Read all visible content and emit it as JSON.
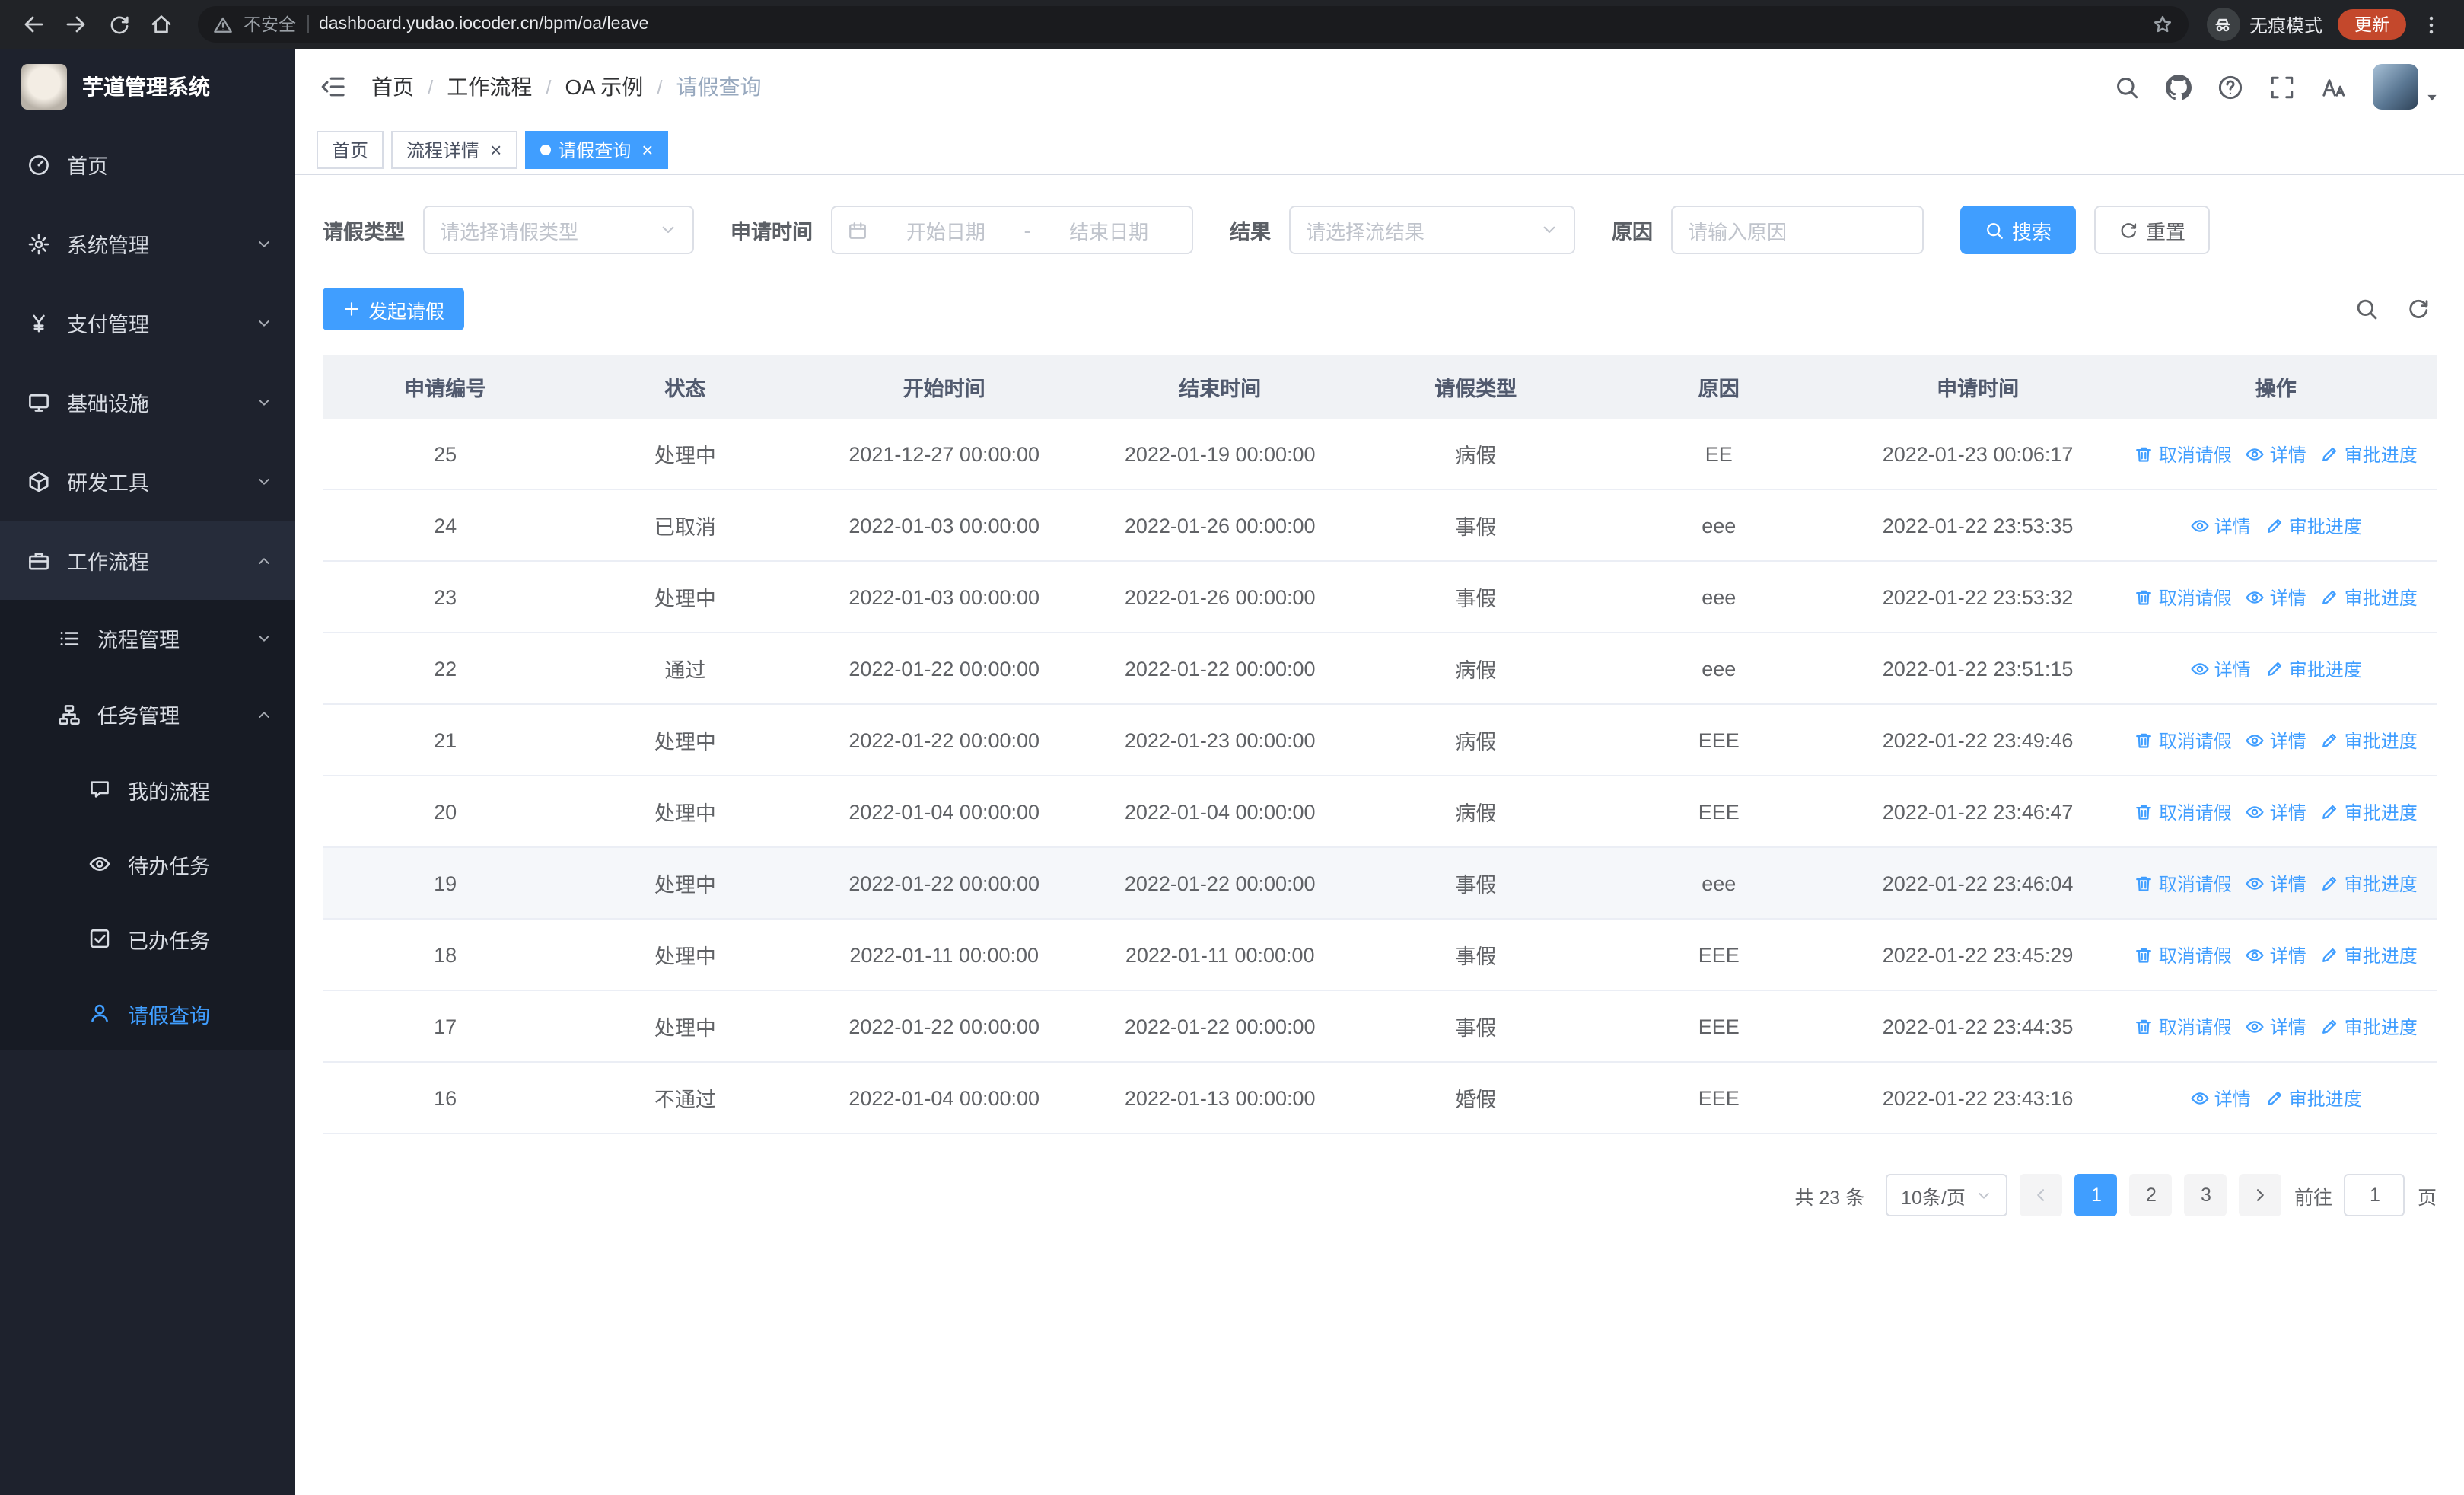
{
  "accent_color": "#409eff",
  "browser": {
    "security_label": "不安全",
    "url": "dashboard.yudao.iocoder.cn/bpm/oa/leave",
    "incognito_label": "无痕模式",
    "update_label": "更新"
  },
  "sidebar": {
    "title": "芋道管理系统",
    "menu": [
      {
        "label": "首页",
        "icon": "dashboard-icon",
        "level": 1
      },
      {
        "label": "系统管理",
        "icon": "gear-icon",
        "level": 1,
        "arrow": "down"
      },
      {
        "label": "支付管理",
        "icon": "yuan-icon",
        "level": 1,
        "arrow": "down"
      },
      {
        "label": "基础设施",
        "icon": "monitor-icon",
        "level": 1,
        "arrow": "down"
      },
      {
        "label": "研发工具",
        "icon": "cube-icon",
        "level": 1,
        "arrow": "down"
      },
      {
        "label": "工作流程",
        "icon": "briefcase-icon",
        "level": 1,
        "arrow": "up",
        "open": true
      },
      {
        "label": "流程管理",
        "icon": "list-icon",
        "level": 2,
        "arrow": "down"
      },
      {
        "label": "任务管理",
        "icon": "tree-icon",
        "level": 2,
        "arrow": "up"
      },
      {
        "label": "我的流程",
        "icon": "chat-icon",
        "level": 3
      },
      {
        "label": "待办任务",
        "icon": "eye-icon",
        "level": 3
      },
      {
        "label": "已办任务",
        "icon": "check-icon",
        "level": 3
      },
      {
        "label": "请假查询",
        "icon": "user-icon",
        "level": 3,
        "active": true
      }
    ]
  },
  "header": {
    "breadcrumb": [
      "首页",
      "工作流程",
      "OA 示例",
      "请假查询"
    ]
  },
  "tabs": [
    {
      "label": "首页",
      "closable": false,
      "active": false
    },
    {
      "label": "流程详情",
      "closable": true,
      "active": false
    },
    {
      "label": "请假查询",
      "closable": true,
      "active": true
    }
  ],
  "filters": {
    "leave_type_label": "请假类型",
    "leave_type_placeholder": "请选择请假类型",
    "apply_time_label": "申请时间",
    "start_date_placeholder": "开始日期",
    "range_separator": "-",
    "end_date_placeholder": "结束日期",
    "result_label": "结果",
    "result_placeholder": "请选择流结果",
    "reason_label": "原因",
    "reason_placeholder": "请输入原因",
    "search_label": "搜索",
    "reset_label": "重置"
  },
  "toolbar": {
    "create_label": "发起请假"
  },
  "table": {
    "columns": [
      "申请编号",
      "状态",
      "开始时间",
      "结束时间",
      "请假类型",
      "原因",
      "申请时间",
      "操作"
    ],
    "op_labels": {
      "cancel": "取消请假",
      "detail": "详情",
      "progress": "审批进度"
    },
    "rows": [
      {
        "id": "25",
        "status": "处理中",
        "start": "2021-12-27 00:00:00",
        "end": "2022-01-19 00:00:00",
        "type": "病假",
        "reason": "EE",
        "applied": "2022-01-23 00:06:17",
        "ops": [
          "cancel",
          "detail",
          "progress"
        ]
      },
      {
        "id": "24",
        "status": "已取消",
        "start": "2022-01-03 00:00:00",
        "end": "2022-01-26 00:00:00",
        "type": "事假",
        "reason": "eee",
        "applied": "2022-01-22 23:53:35",
        "ops": [
          "detail",
          "progress"
        ]
      },
      {
        "id": "23",
        "status": "处理中",
        "start": "2022-01-03 00:00:00",
        "end": "2022-01-26 00:00:00",
        "type": "事假",
        "reason": "eee",
        "applied": "2022-01-22 23:53:32",
        "ops": [
          "cancel",
          "detail",
          "progress"
        ]
      },
      {
        "id": "22",
        "status": "通过",
        "start": "2022-01-22 00:00:00",
        "end": "2022-01-22 00:00:00",
        "type": "病假",
        "reason": "eee",
        "applied": "2022-01-22 23:51:15",
        "ops": [
          "detail",
          "progress"
        ]
      },
      {
        "id": "21",
        "status": "处理中",
        "start": "2022-01-22 00:00:00",
        "end": "2022-01-23 00:00:00",
        "type": "病假",
        "reason": "EEE",
        "applied": "2022-01-22 23:49:46",
        "ops": [
          "cancel",
          "detail",
          "progress"
        ]
      },
      {
        "id": "20",
        "status": "处理中",
        "start": "2022-01-04 00:00:00",
        "end": "2022-01-04 00:00:00",
        "type": "病假",
        "reason": "EEE",
        "applied": "2022-01-22 23:46:47",
        "ops": [
          "cancel",
          "detail",
          "progress"
        ]
      },
      {
        "id": "19",
        "status": "处理中",
        "start": "2022-01-22 00:00:00",
        "end": "2022-01-22 00:00:00",
        "type": "事假",
        "reason": "eee",
        "applied": "2022-01-22 23:46:04",
        "ops": [
          "cancel",
          "detail",
          "progress"
        ],
        "hover": true
      },
      {
        "id": "18",
        "status": "处理中",
        "start": "2022-01-11 00:00:00",
        "end": "2022-01-11 00:00:00",
        "type": "事假",
        "reason": "EEE",
        "applied": "2022-01-22 23:45:29",
        "ops": [
          "cancel",
          "detail",
          "progress"
        ]
      },
      {
        "id": "17",
        "status": "处理中",
        "start": "2022-01-22 00:00:00",
        "end": "2022-01-22 00:00:00",
        "type": "事假",
        "reason": "EEE",
        "applied": "2022-01-22 23:44:35",
        "ops": [
          "cancel",
          "detail",
          "progress"
        ]
      },
      {
        "id": "16",
        "status": "不通过",
        "start": "2022-01-04 00:00:00",
        "end": "2022-01-13 00:00:00",
        "type": "婚假",
        "reason": "EEE",
        "applied": "2022-01-22 23:43:16",
        "ops": [
          "detail",
          "progress"
        ]
      }
    ]
  },
  "pagination": {
    "total_text": "共 23 条",
    "page_size": "10条/页",
    "pages": [
      "1",
      "2",
      "3"
    ],
    "active_page": "1",
    "goto_label": "前往",
    "goto_value": "1",
    "goto_suffix": "页"
  }
}
